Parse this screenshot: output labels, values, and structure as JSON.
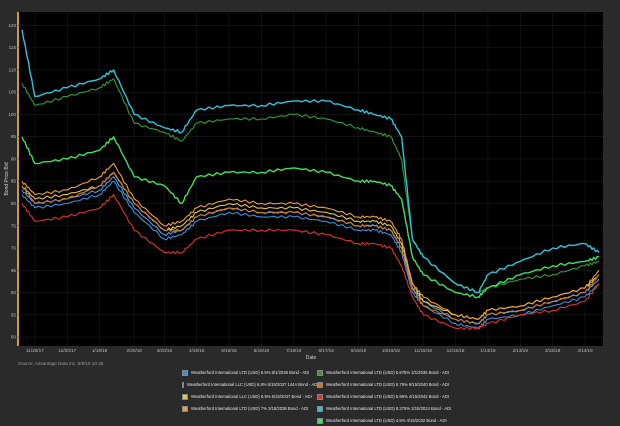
{
  "chart_data": {
    "type": "line",
    "xlabel": "Date",
    "ylabel": "Bond Price Bid",
    "ylim": [
      48,
      123
    ],
    "y_ticks": [
      50,
      55,
      60,
      65,
      70,
      75,
      80,
      85,
      90,
      95,
      100,
      105,
      110,
      115,
      120
    ],
    "x_ticks": [
      "11/20/17",
      "12/20/17",
      "1/19/18",
      "2/20/18",
      "3/20/18",
      "4/19/18",
      "5/19/18",
      "6/18/18",
      "7/18/18",
      "8/17/18",
      "9/16/18",
      "10/16/18",
      "11/15/18",
      "12/15/18",
      "1/14/19",
      "2/13/19",
      "3/15/19",
      "4/14/19"
    ],
    "grid": true,
    "legend_position": "bottom",
    "x": [
      "11/08/17",
      "11/20/17",
      "12/20/17",
      "1/19/18",
      "2/01/18",
      "2/20/18",
      "3/20/18",
      "4/05/18",
      "4/19/18",
      "5/19/18",
      "6/18/18",
      "7/18/18",
      "8/17/18",
      "9/16/18",
      "10/01/18",
      "10/16/18",
      "10/26/18",
      "11/05/18",
      "11/15/18",
      "12/15/18",
      "1/05/19",
      "1/14/19",
      "2/13/19",
      "3/15/19",
      "4/14/19",
      "4/27/19"
    ],
    "series": [
      {
        "name": "Weatherford International LTD (USD) 6.5% 8/1/2036 Bond - ADI",
        "color": "#3a8fdc",
        "values": [
          82,
          79,
          80,
          82,
          85,
          78,
          72,
          73,
          76,
          78,
          77,
          77,
          76,
          74,
          74,
          73,
          69,
          60,
          57,
          53,
          52,
          54,
          55,
          57,
          59,
          62
        ]
      },
      {
        "name": "Weatherford International LLC (USD) 6.8% 6/15/2037 144A Bond - ADI",
        "color": "#4aa0e8",
        "values": [
          83,
          80,
          81,
          83,
          86,
          79,
          73,
          74,
          77,
          79,
          78,
          78,
          77,
          75,
          75,
          74,
          70,
          61,
          58,
          54,
          53,
          55,
          56,
          58,
          60,
          63
        ]
      },
      {
        "name": "Weatherford International LLC (USD) 6.5% 6/15/2037 Bond - ADI",
        "color": "#e6c44a",
        "values": [
          84,
          81,
          82,
          84,
          87,
          80,
          74,
          75,
          78,
          80,
          79,
          79,
          78,
          76,
          76,
          75,
          71,
          62,
          58,
          55,
          54,
          56,
          57,
          59,
          61,
          64
        ]
      },
      {
        "name": "Weatherford International LTD (USD) 7% 3/15/2038 Bond - ADI",
        "color": "#f0a030",
        "values": [
          85,
          82,
          83,
          86,
          89,
          81,
          75,
          76,
          79,
          81,
          80,
          80,
          79,
          77,
          77,
          76,
          72,
          62,
          59,
          55,
          54,
          56,
          57,
          59,
          61,
          65
        ]
      },
      {
        "name": "Weatherford International LTD (USD) 6.875% 3/1/2036 Bond - ADI",
        "color": "#2e9c3a",
        "values": [
          107,
          102,
          104,
          106,
          108,
          98,
          96,
          94,
          98,
          99,
          99,
          100,
          99,
          97,
          96,
          95,
          90,
          72,
          68,
          62,
          60,
          61,
          63,
          64,
          66,
          67
        ]
      },
      {
        "name": "Weatherford International LTD (USD) 6.75% 9/15/2040 Bond - ADI",
        "color": "#d0782a",
        "values": [
          84,
          80,
          81,
          84,
          87,
          80,
          74,
          74,
          77,
          79,
          78,
          78,
          77,
          75,
          75,
          74,
          70,
          61,
          57,
          54,
          53,
          55,
          56,
          58,
          60,
          64
        ]
      },
      {
        "name": "Weatherford International LTD (USD) 5.95% 4/15/2042 Bond - ADI",
        "color": "#e0342a",
        "values": [
          80,
          76,
          77,
          79,
          82,
          74,
          69,
          69,
          72,
          74,
          74,
          74,
          73,
          71,
          71,
          70,
          66,
          59,
          55,
          52,
          52,
          53,
          55,
          56,
          58,
          62
        ]
      },
      {
        "name": "Weatherford International LTD (USD) 8.375% 2/15/2024 Bond - ADI",
        "color": "#2ec3d8",
        "values": [
          119,
          104,
          106,
          108,
          110,
          100,
          97,
          96,
          101,
          102,
          102,
          103,
          103,
          101,
          100,
          99,
          95,
          72,
          68,
          62,
          60,
          64,
          67,
          70,
          71,
          69
        ]
      },
      {
        "name": "Weatherford International LTD (USD) 4.5% 4/15/2022 Bond - ADI",
        "color": "#3ee060",
        "values": [
          95,
          89,
          90,
          92,
          95,
          86,
          84,
          80,
          86,
          87,
          87,
          88,
          87,
          85,
          85,
          84,
          81,
          68,
          64,
          60,
          59,
          61,
          64,
          66,
          67,
          68
        ]
      }
    ]
  },
  "source_note": "Source: Advantage Data Inc. 5/9/19 10:48"
}
